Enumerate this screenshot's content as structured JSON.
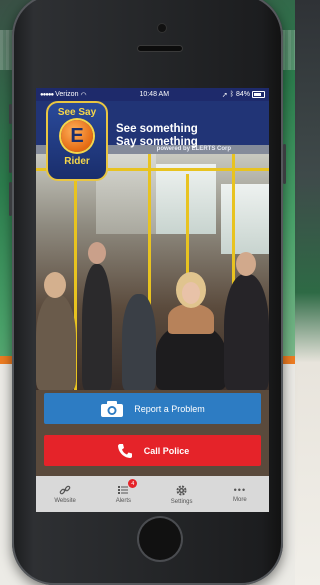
{
  "status_bar": {
    "carrier": "Verizon",
    "time": "10:48 AM",
    "battery": "84%"
  },
  "header": {
    "logo": {
      "top": "See Say",
      "letter": "E",
      "bottom": "Rider"
    },
    "tagline_line1": "See something",
    "tagline_line2": "Say something",
    "powered_by": "powered by ELERTS Corp"
  },
  "actions": {
    "report_label": "Report a Problem",
    "police_label": "Call Police"
  },
  "tabs": [
    {
      "label": "Website",
      "icon": "link-icon"
    },
    {
      "label": "Alerts",
      "icon": "list-icon",
      "badge": "4"
    },
    {
      "label": "Settings",
      "icon": "gear-icon"
    },
    {
      "label": "More",
      "icon": "more-icon"
    }
  ],
  "colors": {
    "header": "#213476",
    "report": "#2d7cc3",
    "police": "#e52329",
    "accent_orange": "#ef7d22"
  }
}
